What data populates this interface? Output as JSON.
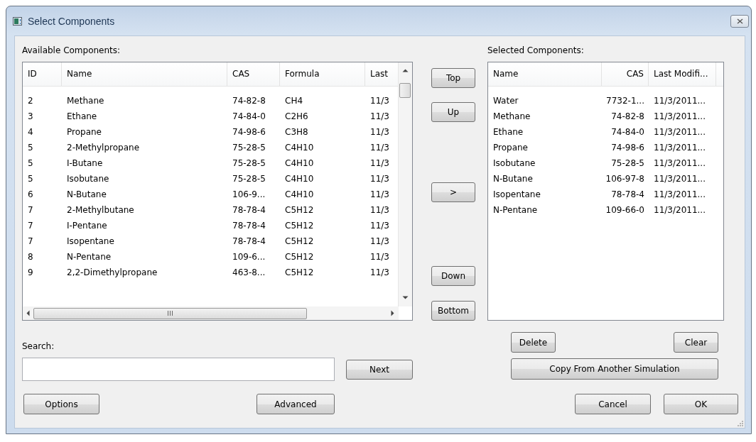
{
  "window": {
    "title": "Select Components"
  },
  "available": {
    "label": "Available Components:",
    "columns": [
      "ID",
      "Name",
      "CAS",
      "Formula",
      "Last"
    ],
    "rows": [
      {
        "id": "2",
        "name": "Methane",
        "cas": "74-82-8",
        "formula": "CH4",
        "last": "11/3",
        "selected": false
      },
      {
        "id": "3",
        "name": "Ethane",
        "cas": "74-84-0",
        "formula": "C2H6",
        "last": "11/3",
        "selected": false
      },
      {
        "id": "4",
        "name": "Propane",
        "cas": "74-98-6",
        "formula": "C3H8",
        "last": "11/3",
        "selected": false
      },
      {
        "id": "5",
        "name": "2-Methylpropane",
        "cas": "75-28-5",
        "formula": "C4H10",
        "last": "11/3",
        "selected": false
      },
      {
        "id": "5",
        "name": "I-Butane",
        "cas": "75-28-5",
        "formula": "C4H10",
        "last": "11/3",
        "selected": false
      },
      {
        "id": "5",
        "name": "Isobutane",
        "cas": "75-28-5",
        "formula": "C4H10",
        "last": "11/3",
        "selected": false
      },
      {
        "id": "6",
        "name": "N-Butane",
        "cas": "106-9...",
        "formula": "C4H10",
        "last": "11/3",
        "selected": false
      },
      {
        "id": "7",
        "name": "2-Methylbutane",
        "cas": "78-78-4",
        "formula": "C5H12",
        "last": "11/3",
        "selected": false
      },
      {
        "id": "7",
        "name": "I-Pentane",
        "cas": "78-78-4",
        "formula": "C5H12",
        "last": "11/3",
        "selected": false
      },
      {
        "id": "7",
        "name": "Isopentane",
        "cas": "78-78-4",
        "formula": "C5H12",
        "last": "11/3",
        "selected": false
      },
      {
        "id": "8",
        "name": "N-Pentane",
        "cas": "109-6...",
        "formula": "C5H12",
        "last": "11/3",
        "selected": false
      },
      {
        "id": "9",
        "name": "2,2-Dimethylpropane",
        "cas": "463-8...",
        "formula": "C5H12",
        "last": "11/3",
        "selected": false
      }
    ]
  },
  "move_buttons": [
    "Top",
    "Up",
    ">",
    "Down",
    "Bottom"
  ],
  "selected": {
    "label": "Selected Components:",
    "columns": [
      "Name",
      "CAS",
      "Last Modifi..."
    ],
    "rows": [
      {
        "name": "Water",
        "cas": "7732-1...",
        "modified": "11/3/2011...",
        "selected": false
      },
      {
        "name": "Methane",
        "cas": "74-82-8",
        "modified": "11/3/2011...",
        "selected": false
      },
      {
        "name": "Ethane",
        "cas": "74-84-0",
        "modified": "11/3/2011...",
        "selected": false
      },
      {
        "name": "Propane",
        "cas": "74-98-6",
        "modified": "11/3/2011...",
        "selected": false
      },
      {
        "name": "Isobutane",
        "cas": "75-28-5",
        "modified": "11/3/2011...",
        "selected": false
      },
      {
        "name": "N-Butane",
        "cas": "106-97-8",
        "modified": "11/3/2011...",
        "selected": false
      },
      {
        "name": "Isopentane",
        "cas": "78-78-4",
        "modified": "11/3/2011...",
        "selected": false
      },
      {
        "name": "N-Pentane",
        "cas": "109-66-0",
        "modified": "11/3/2011...",
        "selected": false
      }
    ]
  },
  "search": {
    "label": "Search:",
    "next": "Next"
  },
  "list_buttons": {
    "delete": "Delete",
    "clear": "Clear",
    "copy": "Copy From Another Simulation"
  },
  "footer": {
    "options": "Options",
    "advanced": "Advanced",
    "cancel": "Cancel",
    "ok": "OK"
  }
}
